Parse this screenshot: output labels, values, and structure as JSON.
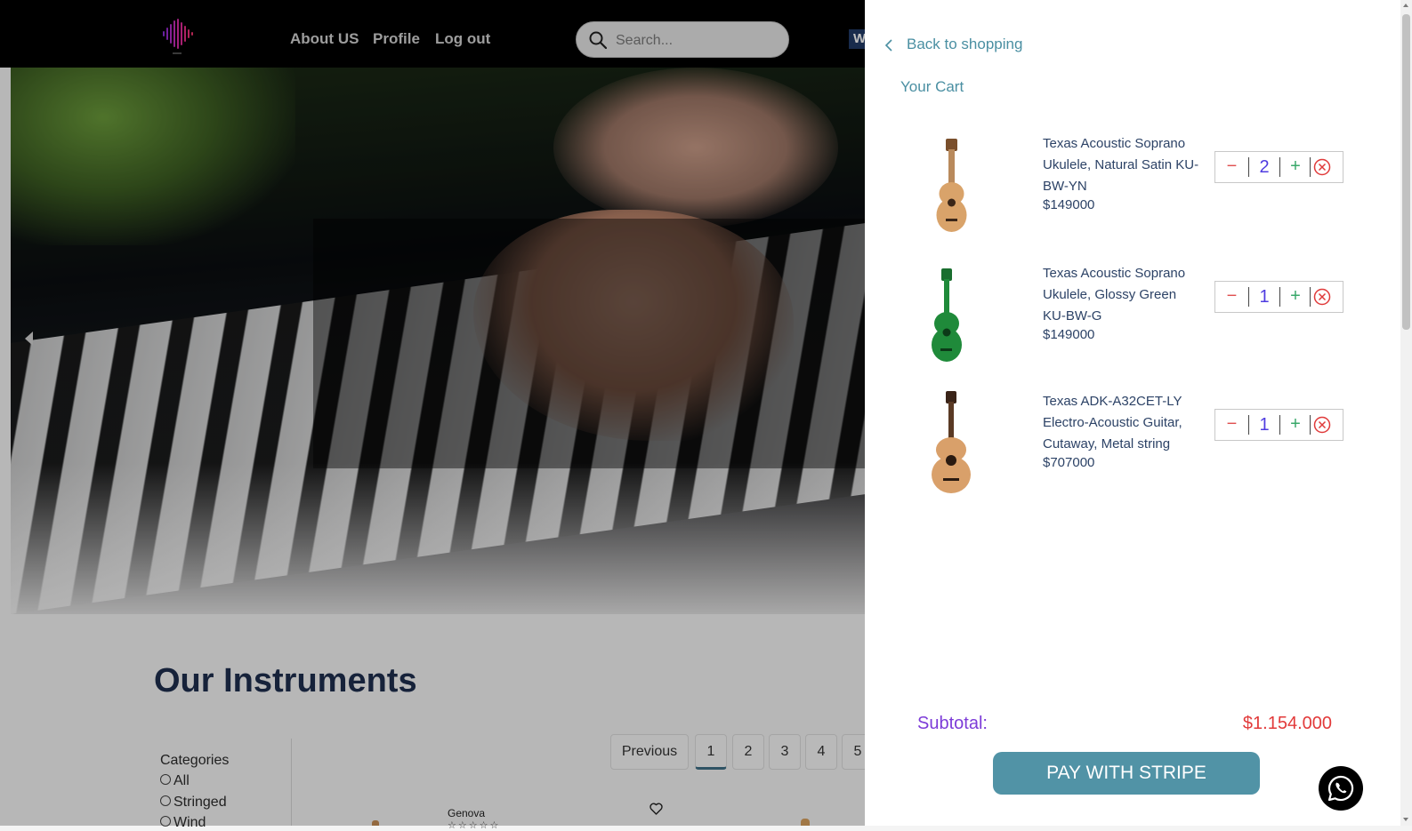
{
  "header": {
    "nav": [
      "About US",
      "Profile",
      "Log out"
    ],
    "search_placeholder": "Search...",
    "badge_text": "W"
  },
  "main": {
    "section_title": "Our Instruments",
    "categories_title": "Categories",
    "categories": [
      "All",
      "Stringed",
      "Wind"
    ],
    "pagination": [
      "Previous",
      "1",
      "2",
      "3",
      "4",
      "5"
    ],
    "active_page": "1",
    "product_brand": "Genova",
    "product_stars": "☆☆☆☆☆"
  },
  "cart": {
    "back_label": "Back to shopping",
    "title": "Your Cart",
    "items": [
      {
        "name": "Texas Acoustic Soprano Ukulele, Natural Satin KU-BW-YN",
        "price": "$149000",
        "qty": "2",
        "color": "#d9a36a"
      },
      {
        "name": "Texas Acoustic Soprano Ukulele, Glossy Green KU-BW-G",
        "price": "$149000",
        "qty": "1",
        "color": "#1f8a3a"
      },
      {
        "name": "Texas ADK-A32CET-LY Electro-Acoustic Guitar, Cutaway, Metal string",
        "price": "$707000",
        "qty": "1",
        "color": "#d9a06a"
      }
    ],
    "qty_minus": "−",
    "qty_plus": "+",
    "subtotal_label": "Subtotal:",
    "subtotal_value": "$1.154.000",
    "pay_label": "PAY WITH STRIPE"
  },
  "colors": {
    "accent": "#5193a6",
    "subtotal_label": "#7d3cd8",
    "subtotal_value": "#e23a3a",
    "minus": "#e05050",
    "plus": "#39a86a",
    "qty_number": "#4f3ce0"
  },
  "icons": {
    "logo": "sound-wave-logo",
    "search": "search-icon",
    "back": "chevron-left-icon",
    "remove": "close-circle-icon",
    "heart": "heart-icon",
    "whatsapp": "whatsapp-icon",
    "hero_prev": "caret-left-icon"
  }
}
